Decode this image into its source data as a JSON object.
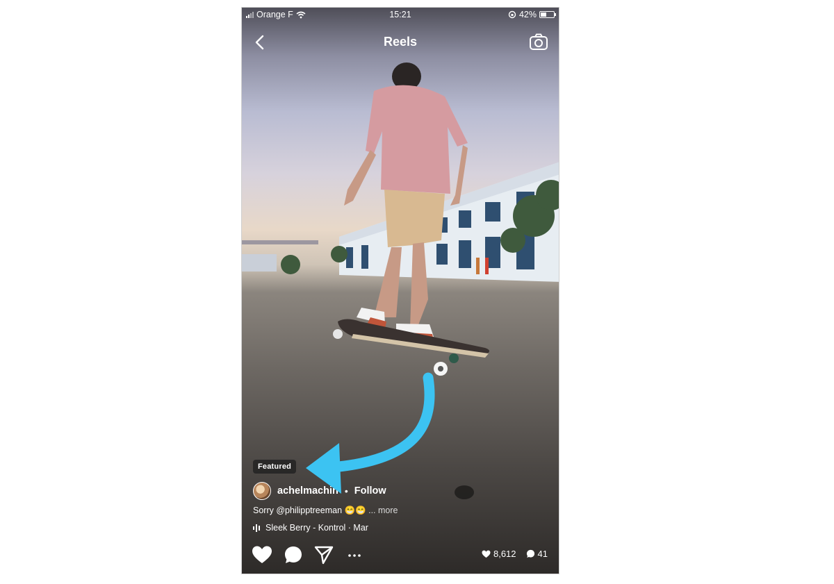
{
  "status_bar": {
    "carrier": "Orange F",
    "time": "15:21",
    "battery": "42%",
    "battery_level": 0.42
  },
  "header": {
    "title": "Reels",
    "back_icon": "chevron-left-icon",
    "camera_icon": "camera-icon"
  },
  "reel": {
    "badge": "Featured",
    "username": "achelmachin",
    "separator": "•",
    "follow_label": "Follow",
    "caption": "Sorry @philipptreeman 😁😁",
    "more_label": "... more",
    "audio": "Sleek Berry - Kontrol · Mar"
  },
  "actions": {
    "like_icon": "heart-icon",
    "comment_icon": "comment-icon",
    "share_icon": "paper-plane-icon",
    "more_icon": "more-dots-icon"
  },
  "counts": {
    "likes": "8,612",
    "comments": "41"
  },
  "colors": {
    "annotation_arrow": "#3cc3f2"
  }
}
